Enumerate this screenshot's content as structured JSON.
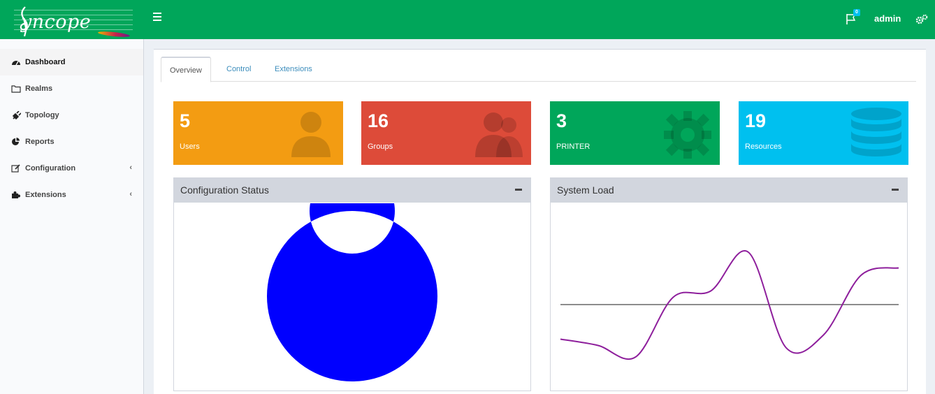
{
  "header": {
    "logo_text": "yncope",
    "notification_count": "0",
    "user_name": "admin"
  },
  "sidebar": {
    "items": [
      {
        "label": "Dashboard",
        "icon": "dashboard-icon",
        "active": true
      },
      {
        "label": "Realms",
        "icon": "folder-icon"
      },
      {
        "label": "Topology",
        "icon": "plug-icon"
      },
      {
        "label": "Reports",
        "icon": "pie-chart-icon"
      },
      {
        "label": "Configuration",
        "icon": "edit-icon",
        "has_submenu": true
      },
      {
        "label": "Extensions",
        "icon": "puzzle-icon",
        "has_submenu": true
      }
    ]
  },
  "tabs": [
    "Overview",
    "Control",
    "Extensions"
  ],
  "tiles": [
    {
      "value": "5",
      "label": "Users",
      "color": "#f39c12",
      "icon": "user-icon"
    },
    {
      "value": "16",
      "label": "Groups",
      "color": "#dd4b39",
      "icon": "users-icon"
    },
    {
      "value": "3",
      "label": "PRINTER",
      "color": "#00a65a",
      "icon": "gear-icon"
    },
    {
      "value": "19",
      "label": "Resources",
      "color": "#00c0ef",
      "icon": "database-icon"
    }
  ],
  "panels": {
    "config_status": {
      "title": "Configuration Status"
    },
    "system_load": {
      "title": "System Load"
    }
  },
  "colors": {
    "header": "#00a65a",
    "donut": "#0000ff",
    "load_line": "#8e1f9c",
    "baseline": "#8c8c8c"
  },
  "chart_data": [
    {
      "type": "pie",
      "donut": true,
      "values": [
        100
      ],
      "colors": [
        "#0000ff"
      ]
    },
    {
      "type": "line",
      "x": [
        0,
        1,
        2,
        3,
        4,
        5,
        6,
        7,
        8,
        9
      ],
      "series": [
        {
          "values": [
            0.17,
            0.11,
            0.0,
            0.57,
            0.63,
            1.0,
            0.09,
            0.21,
            0.78,
            0.85
          ],
          "color": "#8e1f9c"
        },
        {
          "values": [
            0.5,
            0.5,
            0.5,
            0.5,
            0.5,
            0.5,
            0.5,
            0.5,
            0.5,
            0.5
          ],
          "color": "#8c8c8c"
        }
      ],
      "ylim": [
        0,
        1
      ],
      "grid": false
    }
  ]
}
